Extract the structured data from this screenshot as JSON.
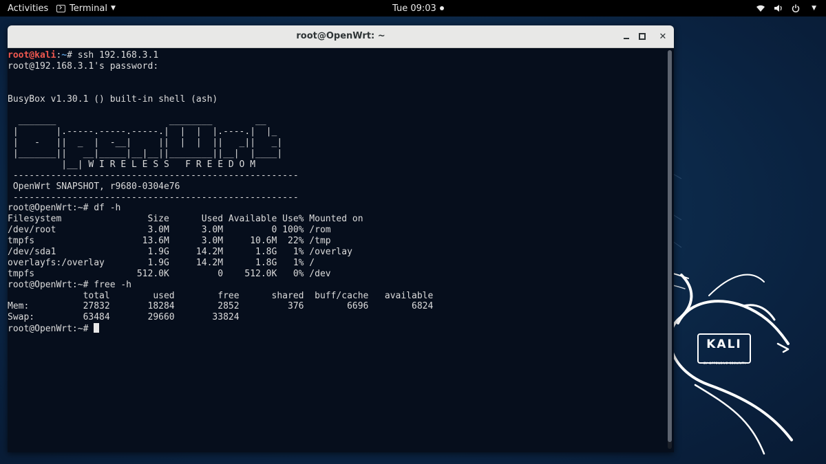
{
  "topbar": {
    "activities": "Activities",
    "app_name": "Terminal",
    "clock": "Tue 09:03",
    "tray_icons": [
      "wifi-icon",
      "volume-icon",
      "power-icon"
    ]
  },
  "window": {
    "title": "root@OpenWrt: ~"
  },
  "terminal": {
    "lines": [
      [
        {
          "t": "root@kali",
          "c": "red"
        },
        {
          "t": ":",
          "c": ""
        },
        {
          "t": "~",
          "c": "blue"
        },
        {
          "t": "# ssh 192.168.3.1",
          "c": ""
        }
      ],
      [
        {
          "t": "root@192.168.3.1's password:",
          "c": ""
        }
      ],
      [
        {
          "t": "",
          "c": ""
        }
      ],
      [
        {
          "t": "",
          "c": ""
        }
      ],
      [
        {
          "t": "BusyBox v1.30.1 () built-in shell (ash)",
          "c": ""
        }
      ],
      [
        {
          "t": "",
          "c": ""
        }
      ],
      [
        {
          "t": "  _______                     ________        __",
          "c": ""
        }
      ],
      [
        {
          "t": " |       |.-----.-----.-----.|  |  |  |.----.|  |_",
          "c": ""
        }
      ],
      [
        {
          "t": " |   -   ||  _  |  -__|     ||  |  |  ||   _||   _|",
          "c": ""
        }
      ],
      [
        {
          "t": " |_______||   __|_____|__|__||________||__|  |____|",
          "c": ""
        }
      ],
      [
        {
          "t": "          |__| W I R E L E S S   F R E E D O M",
          "c": ""
        }
      ],
      [
        {
          "t": " -----------------------------------------------------",
          "c": ""
        }
      ],
      [
        {
          "t": " OpenWrt SNAPSHOT, r9680-0304e76",
          "c": ""
        }
      ],
      [
        {
          "t": " -----------------------------------------------------",
          "c": ""
        }
      ],
      [
        {
          "t": "root@OpenWrt:~# df -h",
          "c": ""
        }
      ],
      [
        {
          "t": "Filesystem                Size      Used Available Use% Mounted on",
          "c": ""
        }
      ],
      [
        {
          "t": "/dev/root                 3.0M      3.0M         0 100% /rom",
          "c": ""
        }
      ],
      [
        {
          "t": "tmpfs                    13.6M      3.0M     10.6M  22% /tmp",
          "c": ""
        }
      ],
      [
        {
          "t": "/dev/sda1                 1.9G     14.2M      1.8G   1% /overlay",
          "c": ""
        }
      ],
      [
        {
          "t": "overlayfs:/overlay        1.9G     14.2M      1.8G   1% /",
          "c": ""
        }
      ],
      [
        {
          "t": "tmpfs                   512.0K         0    512.0K   0% /dev",
          "c": ""
        }
      ],
      [
        {
          "t": "root@OpenWrt:~# free -h",
          "c": ""
        }
      ],
      [
        {
          "t": "              total        used        free      shared  buff/cache   available",
          "c": ""
        }
      ],
      [
        {
          "t": "Mem:          27832       18284        2852         376        6696        6824",
          "c": ""
        }
      ],
      [
        {
          "t": "Swap:         63484       29660       33824",
          "c": ""
        }
      ],
      [
        {
          "t": "root@OpenWrt:~# ",
          "c": "",
          "cursor": true
        }
      ]
    ]
  },
  "wallpaper": {
    "logo_text": "KALI",
    "logo_subtext": "BY OFFENSIVE SECURITY"
  },
  "colors": {
    "background": "#0d2c4d",
    "terminal_bg": "#060e1c",
    "prompt_user": "#f0584f",
    "prompt_path": "#5b9bd5"
  }
}
